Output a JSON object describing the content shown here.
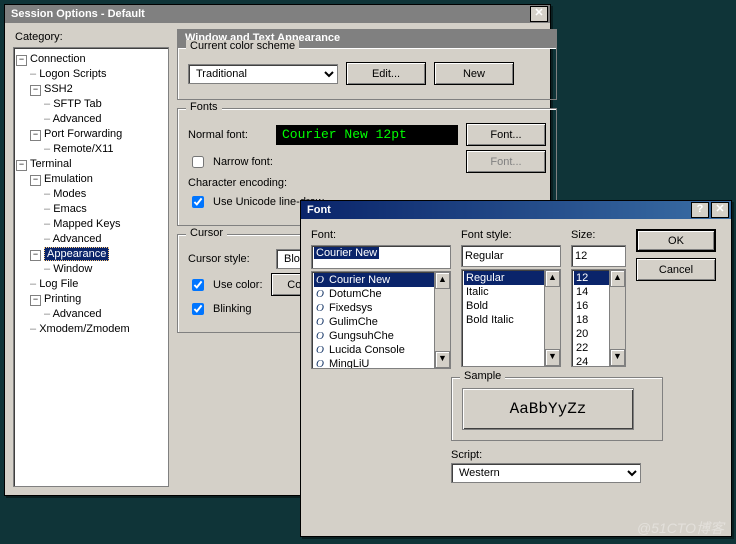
{
  "sessionOptions": {
    "title": "Session Options - Default",
    "categoryLabel": "Category:",
    "tree": [
      {
        "d": 0,
        "tw": "-",
        "label": "Connection"
      },
      {
        "d": 1,
        "tw": "",
        "label": "Logon Scripts"
      },
      {
        "d": 1,
        "tw": "-",
        "label": "SSH2"
      },
      {
        "d": 2,
        "tw": "",
        "label": "SFTP Tab"
      },
      {
        "d": 2,
        "tw": "",
        "label": "Advanced"
      },
      {
        "d": 1,
        "tw": "-",
        "label": "Port Forwarding"
      },
      {
        "d": 2,
        "tw": "",
        "label": "Remote/X11"
      },
      {
        "d": 0,
        "tw": "-",
        "label": "Terminal"
      },
      {
        "d": 1,
        "tw": "-",
        "label": "Emulation"
      },
      {
        "d": 2,
        "tw": "",
        "label": "Modes"
      },
      {
        "d": 2,
        "tw": "",
        "label": "Emacs"
      },
      {
        "d": 2,
        "tw": "",
        "label": "Mapped Keys"
      },
      {
        "d": 2,
        "tw": "",
        "label": "Advanced"
      },
      {
        "d": 1,
        "tw": "-",
        "label": "Appearance",
        "sel": true
      },
      {
        "d": 2,
        "tw": "",
        "label": "Window"
      },
      {
        "d": 1,
        "tw": "",
        "label": "Log File"
      },
      {
        "d": 1,
        "tw": "-",
        "label": "Printing"
      },
      {
        "d": 2,
        "tw": "",
        "label": "Advanced"
      },
      {
        "d": 1,
        "tw": "",
        "label": "Xmodem/Zmodem"
      }
    ],
    "panel": {
      "heading": "Window and Text Appearance",
      "scheme": {
        "legend": "Current color scheme",
        "value": "Traditional",
        "editBtn": "Edit...",
        "newBtn": "New"
      },
      "fonts": {
        "legend": "Fonts",
        "normalLabel": "Normal font:",
        "preview": "Courier New 12pt",
        "fontBtn": "Font...",
        "narrowLabel": "Narrow font:",
        "fontBtnDisabled": "Font...",
        "encodingLabel": "Character encoding:",
        "unicodeLabel": "Use Unicode line-draw"
      },
      "cursor": {
        "legend": "Cursor",
        "styleLabel": "Cursor style:",
        "styleValue": "Block",
        "useColorLabel": "Use color:",
        "colorBtn": "Col",
        "blinkingLabel": "Blinking"
      }
    }
  },
  "fontDialog": {
    "title": "Font",
    "labels": {
      "font": "Font:",
      "style": "Font style:",
      "size": "Size:",
      "sample": "Sample",
      "script": "Script:"
    },
    "fontValue": "Courier New",
    "styleValue": "Regular",
    "sizeValue": "12",
    "fontList": [
      "Courier New",
      "DotumChe",
      "Fixedsys",
      "GulimChe",
      "GungsuhChe",
      "Lucida Console",
      "MingLiU"
    ],
    "styleList": [
      "Regular",
      "Italic",
      "Bold",
      "Bold Italic"
    ],
    "sizeList": [
      "12",
      "14",
      "16",
      "18",
      "20",
      "22",
      "24"
    ],
    "fontSelectedIndex": 0,
    "styleSelectedIndex": 0,
    "sizeSelectedIndex": 0,
    "sampleText": "AaBbYyZz",
    "scriptValue": "Western",
    "buttons": {
      "ok": "OK",
      "cancel": "Cancel"
    }
  },
  "watermark": "@51CTO博客"
}
